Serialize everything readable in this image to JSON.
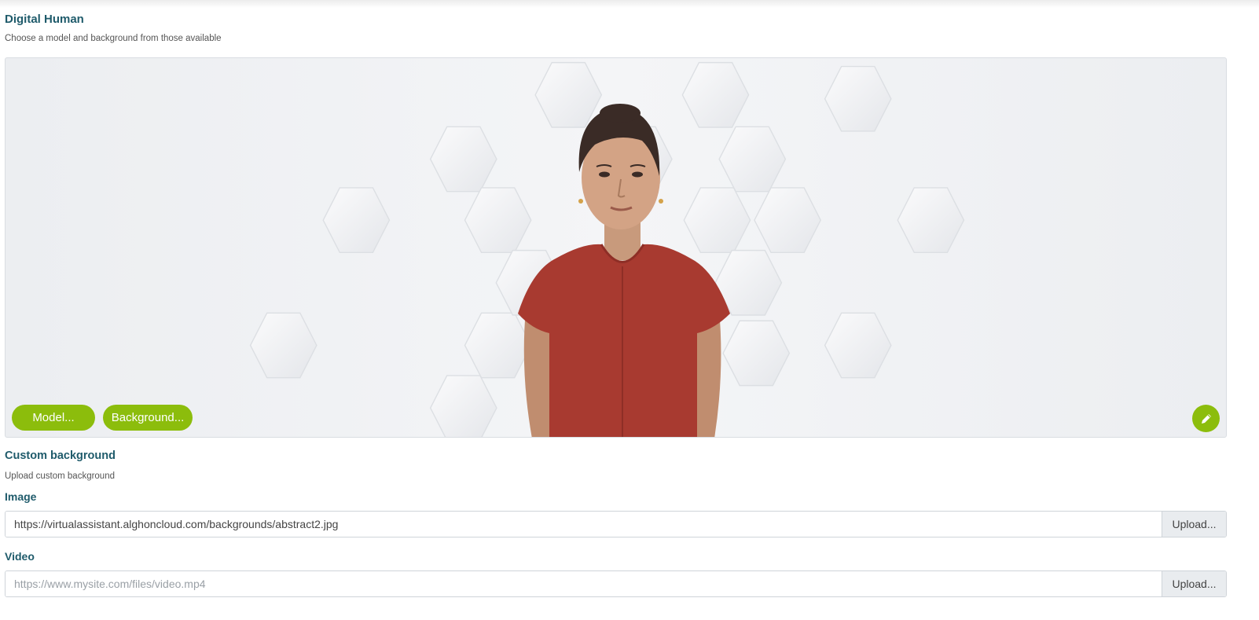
{
  "digital_human": {
    "title": "Digital Human",
    "subtitle": "Choose a model and background from those available",
    "model_button": "Model...",
    "background_button": "Background...",
    "edit_icon": "pencil-icon"
  },
  "custom_background": {
    "title": "Custom background",
    "subtitle": "Upload custom background"
  },
  "image_field": {
    "label": "Image",
    "value": "https://virtualassistant.alghoncloud.com/backgrounds/abstract2.jpg",
    "placeholder": "",
    "upload_label": "Upload..."
  },
  "video_field": {
    "label": "Video",
    "value": "",
    "placeholder": "https://www.mysite.com/files/video.mp4",
    "upload_label": "Upload..."
  },
  "colors": {
    "accent": "#8cbd0c",
    "heading": "#1f5b6b",
    "dress": "#a83a30"
  }
}
